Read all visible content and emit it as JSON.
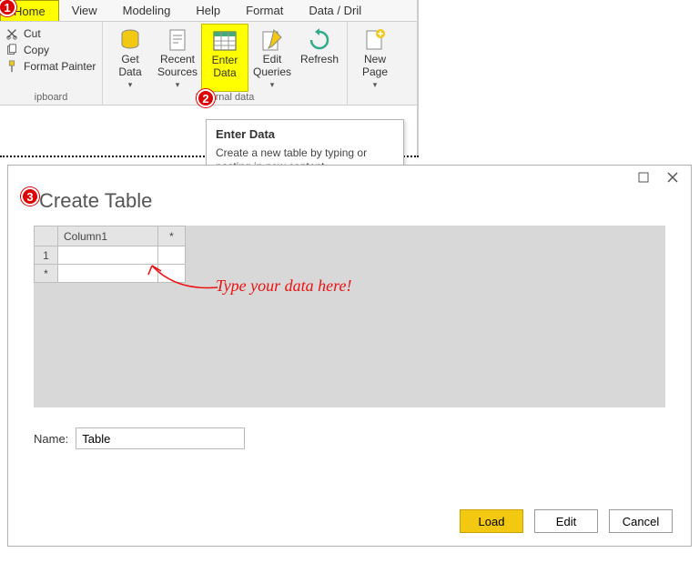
{
  "callouts": {
    "1": "1",
    "2": "2",
    "3": "3"
  },
  "tabs": {
    "home": "Home",
    "view": "View",
    "modeling": "Modeling",
    "help": "Help",
    "format": "Format",
    "data": "Data / Dril"
  },
  "clipboard": {
    "cut": "Cut",
    "copy": "Copy",
    "paint": "Format Painter",
    "group": "ipboard"
  },
  "external": {
    "getdata": "Get\nData",
    "recent": "Recent\nSources",
    "enter": "Enter\nData",
    "edit": "Edit\nQueries",
    "refresh": "Refresh",
    "group": "External data"
  },
  "insert": {
    "newpage": "New\nPage"
  },
  "tooltip": {
    "title": "Enter Data",
    "body": "Create a new table by typing or pasting in new content."
  },
  "dialog": {
    "title": "Create Table",
    "col1": "Column1",
    "addcol": "*",
    "row1": "1",
    "rownew": "*",
    "annotation": "Type your data here!",
    "name_label": "Name:",
    "name_value": "Table",
    "load": "Load",
    "edit": "Edit",
    "cancel": "Cancel"
  },
  "dropdown_caret": "▾"
}
